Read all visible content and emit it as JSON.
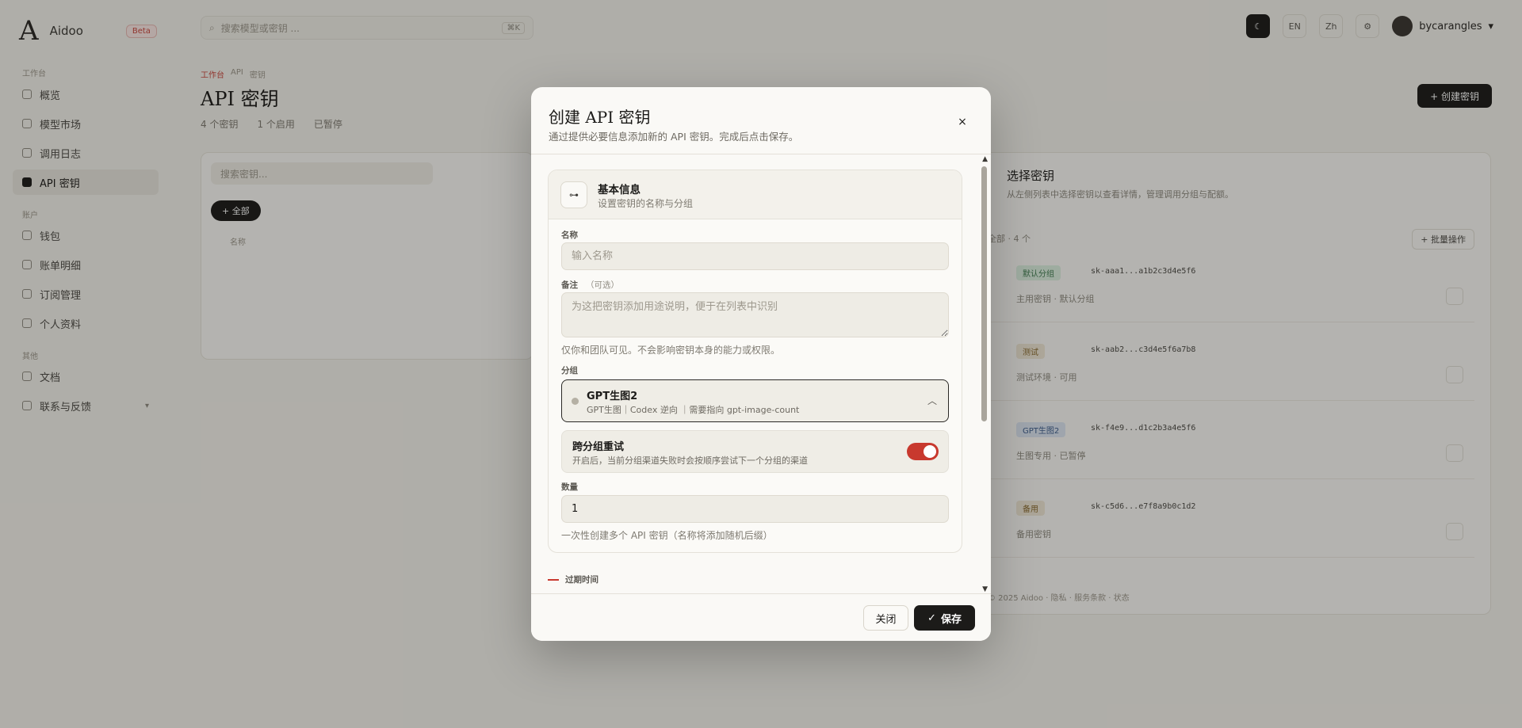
{
  "background": {
    "logo": {
      "mark": "A",
      "name": "Aidoo",
      "tag": "Beta"
    },
    "sidebar": {
      "sections": [
        "工作台",
        "账户",
        "其他"
      ],
      "items": [
        {
          "label": "概览"
        },
        {
          "label": "模型市场"
        },
        {
          "label": "调用日志"
        },
        {
          "label": "API 密钥"
        },
        {
          "label": "钱包"
        },
        {
          "label": "账单明细"
        },
        {
          "label": "订阅管理"
        },
        {
          "label": "个人资料"
        },
        {
          "label": "文档"
        },
        {
          "label": "联系与反馈"
        }
      ]
    },
    "topbar": {
      "search_placeholder": "搜索模型或密钥 ...",
      "shortcut": "⌘K",
      "buttons": [
        "☾",
        "EN",
        "Zh",
        "⚙"
      ],
      "user_name": "bycarangles"
    },
    "page": {
      "breadcrumb": [
        "工作台",
        "API",
        "密钥"
      ],
      "title": "API 密钥",
      "stats": [
        "4 个密钥",
        "1 个启用",
        "已暂停"
      ],
      "create_label": "+ 创建密钥"
    },
    "left_panel": {
      "search_placeholder": "搜索密钥...",
      "pill_label": "+ 全部",
      "column": "名称"
    },
    "right_panel": {
      "title": "选择密钥",
      "subtitle": "从左侧列表中选择密钥以查看详情，管理调用分组与配额。",
      "filter": "全部 · 4 个",
      "action": "+ 批量操作",
      "rows": [
        {
          "badge": "默认分组",
          "badge_color": "#dcefe0",
          "value": "sk-aaa1...a1b2c3d4e5f6",
          "note": "主用密钥 · 默认分组"
        },
        {
          "badge": "测试",
          "badge_color": "#efe7d6",
          "value": "sk-aab2...c3d4e5f6a7b8",
          "note": "测试环境 · 可用"
        },
        {
          "badge": "GPT生图2",
          "badge_color": "#dde6f3",
          "value": "sk-f4e9...d1c2b3a4e5f6",
          "note": "生图专用 · 已暂停"
        },
        {
          "badge": "备用",
          "badge_color": "#efe7d6",
          "value": "sk-c5d6...e7f8a9b0c1d2",
          "note": "备用密钥"
        }
      ],
      "footer": "© 2025 Aidoo · 隐私 · 服务条款 · 状态"
    }
  },
  "modal": {
    "title": "创建 API 密钥",
    "description": "通过提供必要信息添加新的 API 密钥。完成后点击保存。",
    "close_icon": "×",
    "section": {
      "icon": "⊶",
      "title": "基本信息",
      "subtitle": "设置密钥的名称与分组"
    },
    "name": {
      "label": "名称",
      "placeholder": "输入名称",
      "value": ""
    },
    "remark": {
      "label": "备注",
      "optional": "（可选）",
      "placeholder": "为这把密钥添加用途说明，便于在列表中识别",
      "hint": "仅你和团队可见。不会影响密钥本身的能力或权限。"
    },
    "group": {
      "label": "分组",
      "selected_name": "GPT生图2",
      "selected_desc": "GPT生图｜Codex 逆向 ｜需要指向 gpt-image-count",
      "chevron": "︿"
    },
    "cross_group_retry": {
      "title": "跨分组重试",
      "description": "开启后，当前分组渠道失败时会按顺序尝试下一个分组的渠道",
      "enabled": true
    },
    "quantity": {
      "label": "数量",
      "value": "1",
      "hint": "一次性创建多个 API 密钥（名称将添加随机后缀）"
    },
    "next_section": "过期时间",
    "scroll": {
      "up": "▲",
      "down": "▼"
    },
    "footer": {
      "close_label": "关闭",
      "save_label": "保存",
      "save_icon": "✓"
    }
  }
}
